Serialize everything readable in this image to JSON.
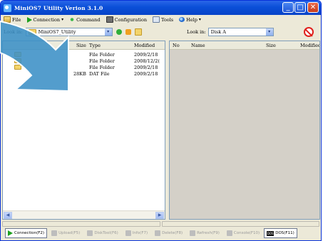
{
  "window": {
    "title": "MiniOS7 Utility Verion 3.1.0",
    "controls": {
      "minimize": "_",
      "maximize": "□",
      "close": "✕"
    }
  },
  "menu": {
    "items": [
      {
        "label": "File",
        "icon": "file-icon"
      },
      {
        "label": "Connection",
        "icon": "connection-icon",
        "has_dropdown": true
      },
      {
        "label": "Command",
        "icon": "command-icon"
      },
      {
        "label": "Configuration",
        "icon": "configuration-icon"
      },
      {
        "label": "Tools",
        "icon": "tools-icon"
      },
      {
        "label": "Help",
        "icon": "help-icon",
        "has_dropdown": true
      }
    ]
  },
  "left_pane": {
    "look_in_label": "Look in:",
    "look_in_value": "MiniOS7_Utility",
    "columns": [
      "Size",
      "Type",
      "Modified"
    ],
    "rows": [
      {
        "size": "",
        "type": "File Folder",
        "modified": "2009/2/18"
      },
      {
        "size": "",
        "type": "File Folder",
        "modified": "2008/12/2("
      },
      {
        "size": "",
        "type": "File Folder",
        "modified": "2009/2/18"
      },
      {
        "size": "28KB",
        "type": "DAT File",
        "modified": "2009/2/18"
      }
    ]
  },
  "right_pane": {
    "look_in_label": "Look in:",
    "look_in_value": "Disk A",
    "columns": [
      "No",
      "Name",
      "Size",
      "Modified"
    ]
  },
  "function_keys": [
    {
      "label": "Connection(F2)",
      "enabled": true
    },
    {
      "label": "Upload(F5)",
      "enabled": false
    },
    {
      "label": "DiskTool(F6)",
      "enabled": false
    },
    {
      "label": "Info(F7)",
      "enabled": false
    },
    {
      "label": "Delete(F8)",
      "enabled": false
    },
    {
      "label": "Refresh(F9)",
      "enabled": false
    },
    {
      "label": "Console(F10)",
      "enabled": false
    },
    {
      "label": "DOS(F11)",
      "enabled": true,
      "icon_text": "DOS"
    }
  ],
  "colors": {
    "titlebar": "#0a4fd8",
    "window_bg": "#ece9d8",
    "overlay_arrow": "#3b8fc6"
  }
}
